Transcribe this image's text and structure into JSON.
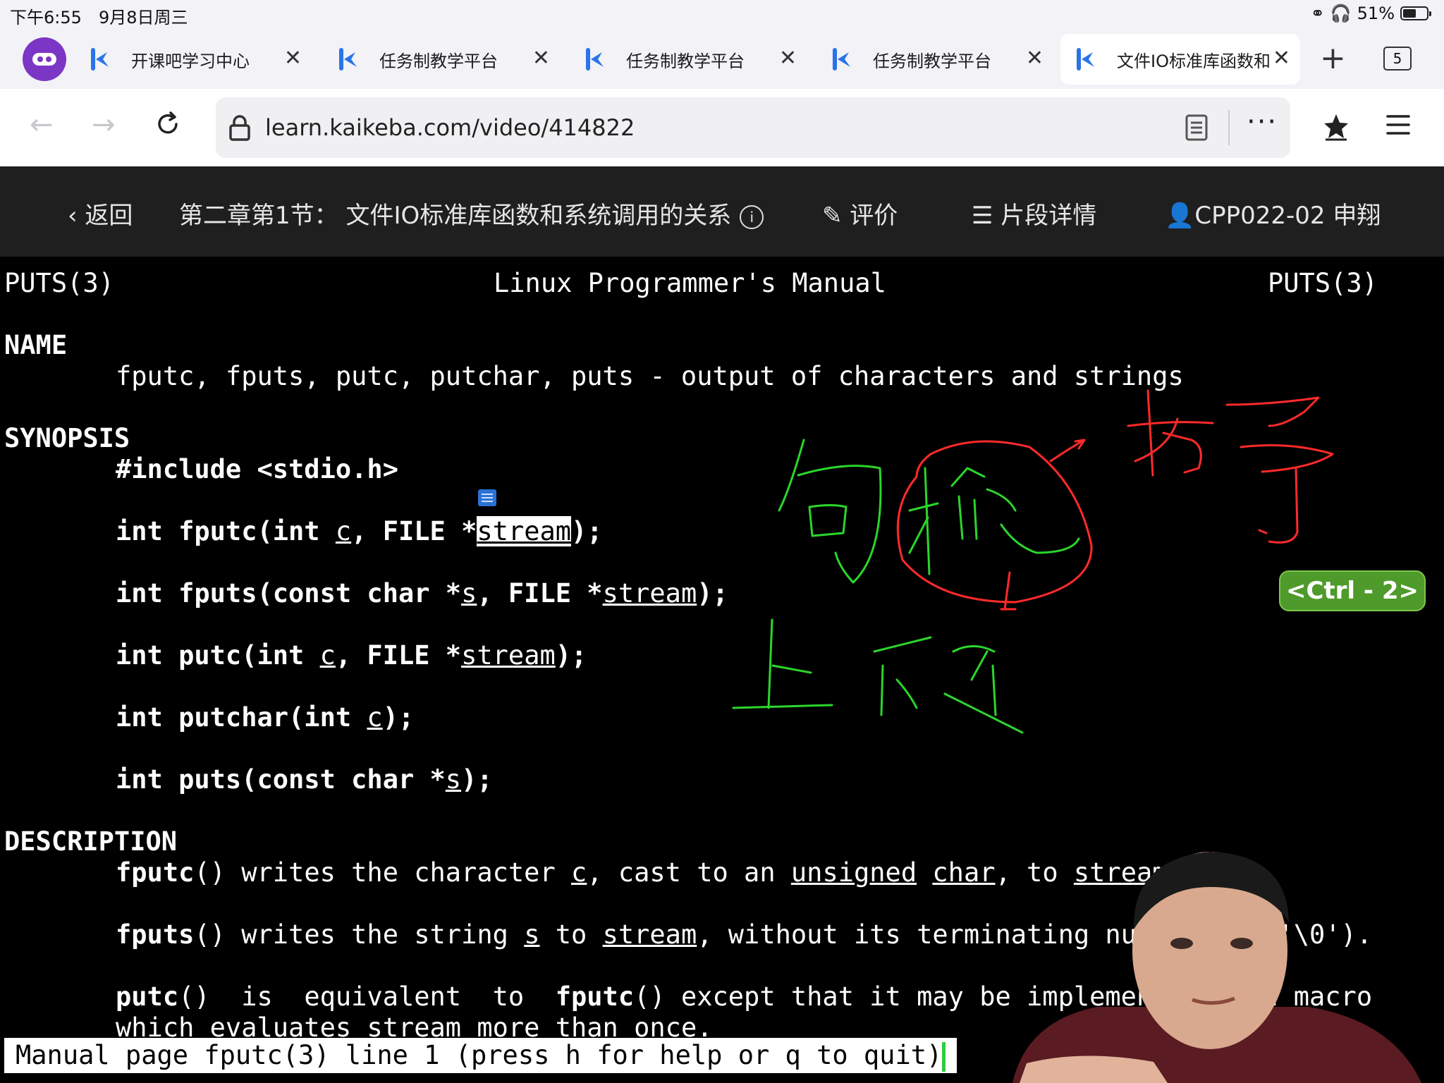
{
  "status_bar": {
    "time": "下午6:55",
    "date": "9月8日周三",
    "battery": "51%",
    "battery_level": 0.51
  },
  "tabs": [
    {
      "label": "开课吧学习中心",
      "active": false
    },
    {
      "label": "任务制教学平台",
      "active": false
    },
    {
      "label": "任务制教学平台",
      "active": false
    },
    {
      "label": "任务制教学平台",
      "active": false
    },
    {
      "label": "文件IO标准库函数和",
      "active": true
    }
  ],
  "tab_count": "5",
  "address": {
    "url": "learn.kaikeba.com/video/414822"
  },
  "course": {
    "back": "返回",
    "title": "第二章第1节：  文件IO标准库函数和系统调用的关系",
    "info": "i",
    "rate": "评价",
    "segments": "片段详情",
    "user": "CPP022-02 申翔"
  },
  "man_page": {
    "header_left": "PUTS(3)",
    "header_center": "Linux Programmer's Manual",
    "header_right": "PUTS(3)",
    "name_heading": "NAME",
    "name_desc": "fputc, fputs, putc, putchar, puts - output of characters and strings",
    "synopsis_heading": "SYNOPSIS",
    "include": "#include <stdio.h>",
    "description_heading": "DESCRIPTION",
    "status_line": "Manual page fputc(3) line 1 (press h for help or q to quit)"
  },
  "shortcut_badge": "<Ctrl - 2>",
  "colors": {
    "ink_red": "#ff2a2a",
    "ink_green": "#2bd62b",
    "badge": "#4e9a2a",
    "course_bar": "#1f1f1f"
  },
  "icons": [
    "kaikeba-logo",
    "close-icon",
    "plus-icon",
    "lock-icon",
    "reload-icon",
    "reader-icon",
    "star-icon",
    "menu-icon",
    "info-icon",
    "edit-icon",
    "list-icon",
    "user-icon"
  ]
}
